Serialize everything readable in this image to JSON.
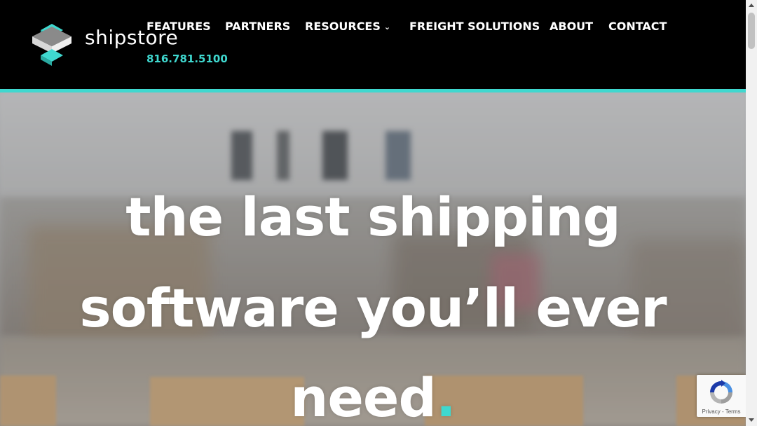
{
  "brand": {
    "name": "shipstore",
    "phone": "816.781.5100",
    "accent_color": "#3fd8cf"
  },
  "nav": {
    "items": [
      {
        "label": "FEATURES",
        "has_dropdown": false
      },
      {
        "label": "PARTNERS",
        "has_dropdown": false
      },
      {
        "label": "RESOURCES",
        "has_dropdown": true
      },
      {
        "label": "FREIGHT SOLUTIONS",
        "has_dropdown": false
      },
      {
        "label": "ABOUT",
        "has_dropdown": false
      },
      {
        "label": "CONTACT",
        "has_dropdown": false
      }
    ]
  },
  "hero": {
    "line1": "the last shipping",
    "line2": "software you’ll ever",
    "line3": "need",
    "period": "."
  },
  "icons": {
    "logo": "shipstore-logo-icon",
    "chevron": "chevron-down-icon",
    "recaptcha": "recaptcha-icon"
  },
  "recaptcha": {
    "links": "Privacy - Terms"
  }
}
